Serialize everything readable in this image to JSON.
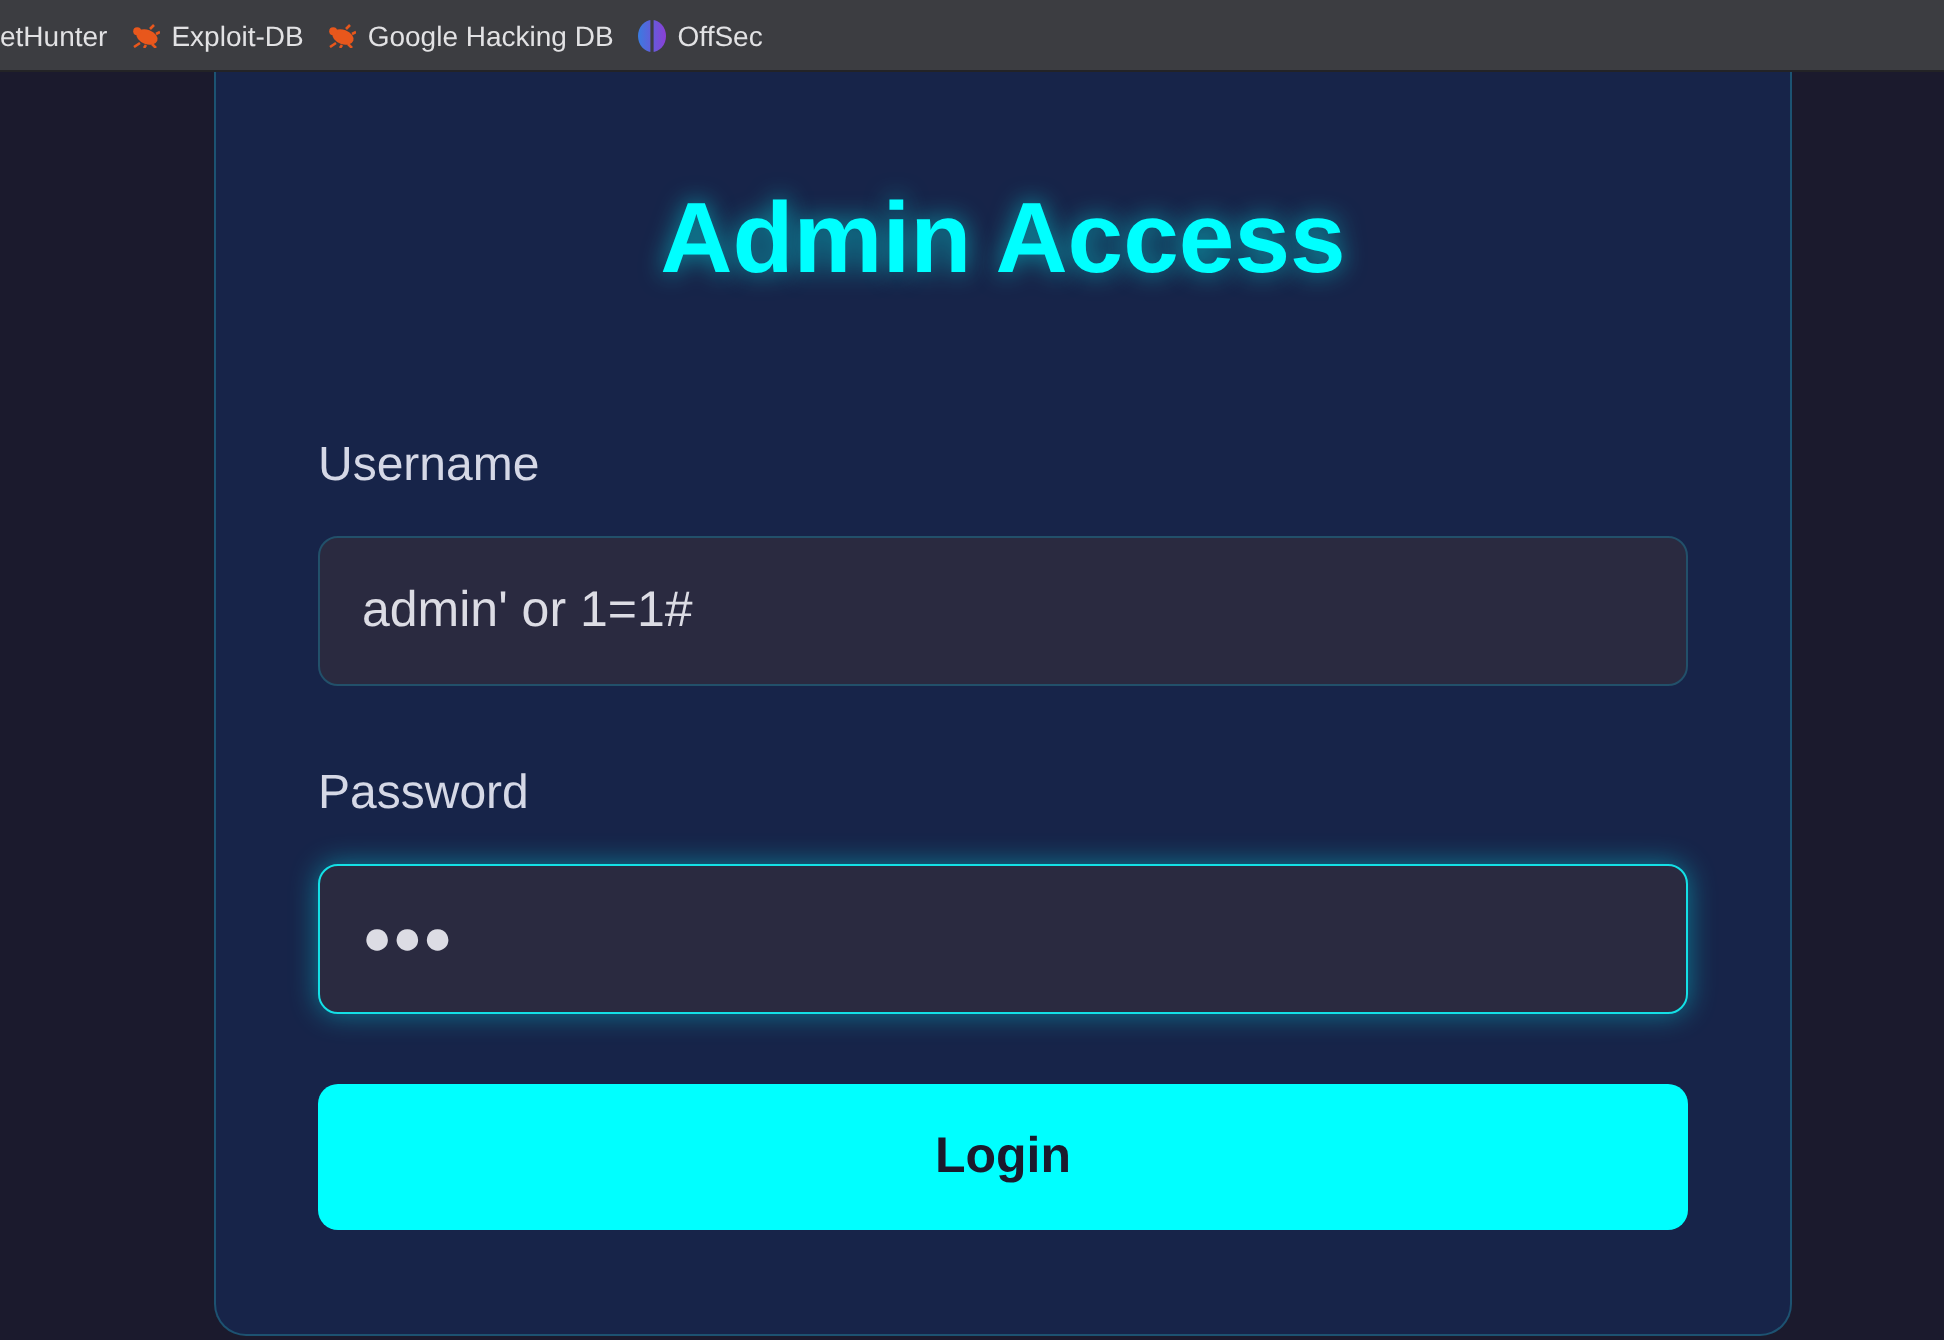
{
  "bookmarks_bar": {
    "items": [
      {
        "label": "etHunter",
        "kind": "plain"
      },
      {
        "label": "Exploit-DB",
        "kind": "bug"
      },
      {
        "label": "Google Hacking DB",
        "kind": "bug"
      },
      {
        "label": "OffSec",
        "kind": "orb"
      }
    ]
  },
  "login_form": {
    "title": "Admin Access",
    "fields": [
      {
        "label": "Username",
        "value": "admin' or 1=1#",
        "focused": false
      },
      {
        "label": "Password",
        "value": "●●●",
        "focused": true
      }
    ],
    "submit_button": {
      "label": "Login"
    }
  }
}
